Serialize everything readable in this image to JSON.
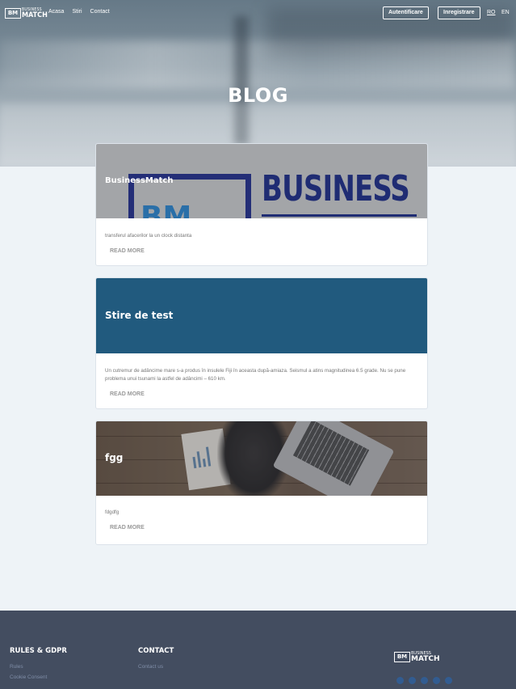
{
  "header": {
    "logo": {
      "mark": "BM",
      "line1": "BUSINESS",
      "line2": "MATCH"
    },
    "nav": [
      "Acasa",
      "Stiri",
      "Contact"
    ],
    "login_label": "Autentificare",
    "register_label": "Inregistrare",
    "lang_ro": "RO",
    "lang_en": "EN"
  },
  "hero": {
    "title": "BLOG"
  },
  "posts": [
    {
      "title": "BusinessMatch",
      "excerpt": "transferul afacerilor la un clock distanta",
      "read_more": "READ MORE",
      "media_text": "BUSINESS",
      "media_mark": "BM"
    },
    {
      "title": "Stire de test",
      "excerpt": "Un cutremur de adâncime mare s-a produs în insulele Fiji în aceasta după-amiaza. Seismul a atins magnitudinea 6.5 grade. Nu se pune problema unui tsunami la astfel de adâncimi – 610 km.",
      "read_more": "READ MORE"
    },
    {
      "title": "fgg",
      "excerpt": "fdgdfg",
      "read_more": "READ MORE"
    }
  ],
  "footer": {
    "rules_heading": "RULES & GDPR",
    "rules_links": [
      "Rules",
      "Cookie Consent"
    ],
    "contact_heading": "CONTACT",
    "contact_links": [
      "Contact us"
    ],
    "logo": {
      "mark": "BM",
      "line1": "BUSINESS",
      "line2": "MATCH"
    },
    "social_icons": [
      "facebook-icon",
      "twitter-icon",
      "linkedin-icon",
      "instagram-icon",
      "youtube-icon"
    ]
  }
}
